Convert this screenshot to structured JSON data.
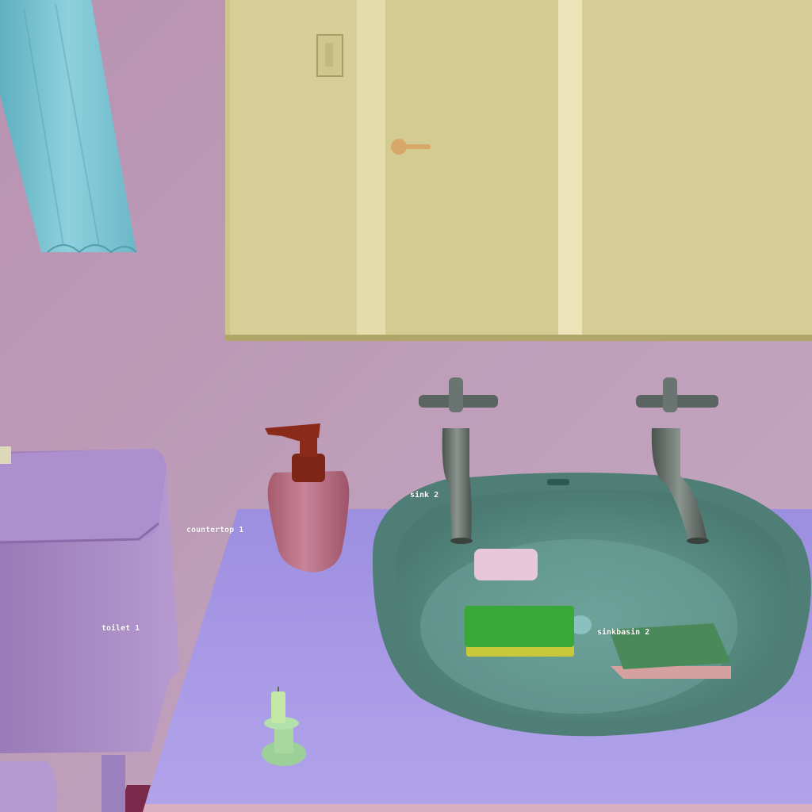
{
  "scene": {
    "colors": {
      "wall": "#b99ab4",
      "mirror_frame": "#b8ae6c",
      "door": "#d8cf96",
      "countertop": "#a99ae6",
      "toilet": "#a88ac6",
      "sink_basin": "#5a8c84",
      "curtain": "#7fc4d0",
      "soap_dispenser": "#b86a7c",
      "pump_head": "#8a2a1a",
      "candle_holder": "#a8d8a0",
      "sponge_green": "#3aa838",
      "sponge_yellow": "#c8c838",
      "soap_bar": "#e8c8d8",
      "dish_green": "#4a8a5a",
      "dish_pink": "#d4a0a0",
      "faucet": "#606a66"
    },
    "objects": [
      {
        "key": "sink",
        "label": "sink 2"
      },
      {
        "key": "countertop",
        "label": "countertop 1"
      },
      {
        "key": "toilet",
        "label": "toilet 1"
      },
      {
        "key": "sinkbasin",
        "label": "sinkbasin 2"
      }
    ]
  }
}
